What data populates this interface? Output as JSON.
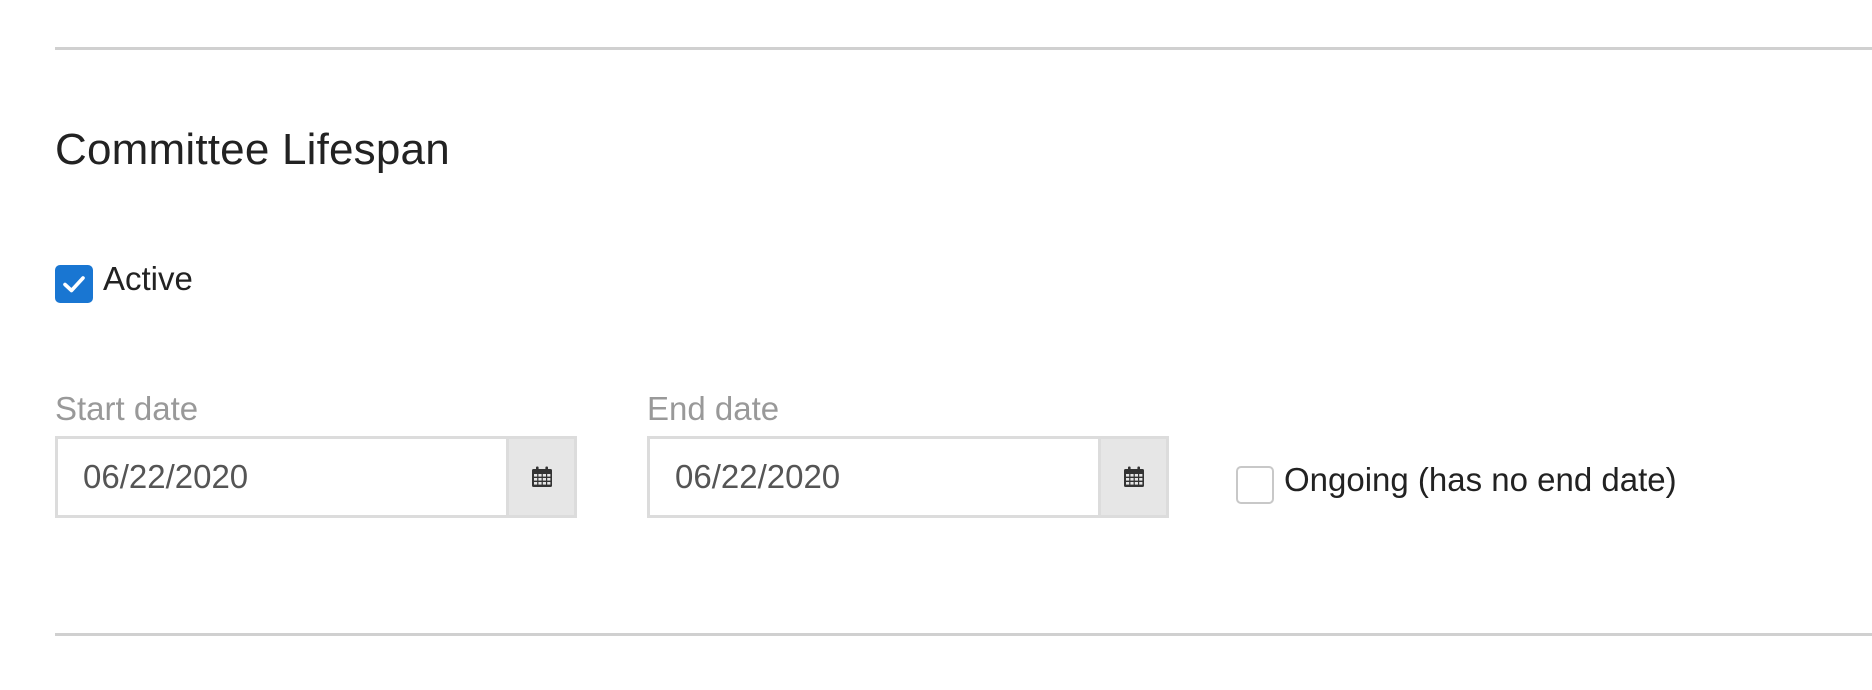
{
  "section": {
    "title": "Committee Lifespan"
  },
  "active": {
    "label": "Active",
    "checked": true
  },
  "start_date": {
    "label": "Start date",
    "value": "06/22/2020"
  },
  "end_date": {
    "label": "End date",
    "value": "06/22/2020"
  },
  "ongoing": {
    "label": "Ongoing (has no end date)",
    "checked": false
  },
  "icons": {
    "calendar": "calendar-icon",
    "checkmark": "checkmark-icon"
  },
  "colors": {
    "accent": "#1976d2",
    "label_muted": "#999999",
    "divider": "#d0d0d0",
    "button_bg": "#e6e6e6"
  }
}
